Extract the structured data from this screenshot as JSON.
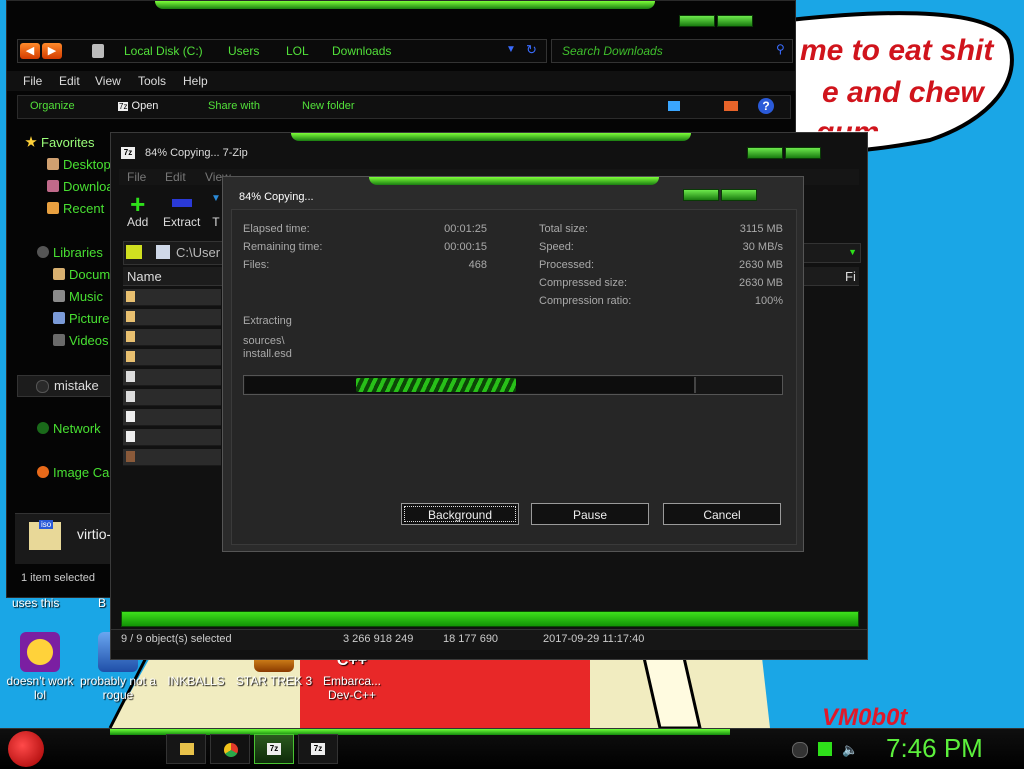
{
  "wallpaper": {
    "speech_lines": [
      "me to eat shit",
      "e and chew",
      "gum"
    ],
    "watermark": "VM0b0t"
  },
  "desktop_icons": [
    {
      "label": "doesn't work lol",
      "color": "#e02a6a"
    },
    {
      "label": "probably not a rogue",
      "color": "#3a78d8"
    },
    {
      "label": "INKBALLS",
      "color": "#d8302a"
    },
    {
      "label": "STAR TREK 3",
      "color": "#c89a2a"
    },
    {
      "label": "Embarca... Dev-C++",
      "color": "#c02a2a"
    }
  ],
  "desktop_top_labels": [
    "uses this",
    "B"
  ],
  "explorer": {
    "address": {
      "crumbs": [
        "Local Disk (C:)",
        "Users",
        "LOL",
        "Downloads"
      ]
    },
    "search_placeholder": "Search Downloads",
    "menu": [
      "File",
      "Edit",
      "View",
      "Tools",
      "Help"
    ],
    "commands": {
      "organize": "Organize",
      "open": "Open",
      "share": "Share with",
      "new_folder": "New folder"
    },
    "nav": {
      "favorites": "Favorites",
      "desktop": "Desktop",
      "downloads": "Downloads",
      "recent": "Recent",
      "libraries": "Libraries",
      "documents": "Documents",
      "music": "Music",
      "pictures": "Pictures",
      "videos": "Videos",
      "mistake": "mistake",
      "network": "Network",
      "image": "Image Ca"
    },
    "selected_file": "virtio-",
    "status": "1 item selected"
  },
  "zip": {
    "title": "84% Copying... 7-Zip",
    "menu": [
      "File",
      "Edit",
      "View"
    ],
    "tools": {
      "add": "Add",
      "extract": "Extract",
      "test": "T"
    },
    "path": "C:\\User",
    "column_name": "Name",
    "column_fi": "Fi",
    "status": {
      "objects": "9 / 9 object(s) selected",
      "size": "3 266 918 249",
      "packed": "18 177 690",
      "date": "2017-09-29 11:17:40"
    }
  },
  "dialog": {
    "title": "84% Copying...",
    "left_stats": [
      {
        "label": "Elapsed time:",
        "value": "00:01:25"
      },
      {
        "label": "Remaining time:",
        "value": "00:00:15"
      },
      {
        "label": "Files:",
        "value": "468"
      }
    ],
    "right_stats": [
      {
        "label": "Total size:",
        "value": "3115 MB"
      },
      {
        "label": "Speed:",
        "value": "30 MB/s"
      },
      {
        "label": "Processed:",
        "value": "2630 MB"
      },
      {
        "label": "Compressed size:",
        "value": "2630 MB"
      },
      {
        "label": "Compression ratio:",
        "value": "100%"
      }
    ],
    "operation": "Extracting",
    "path_line1": "sources\\",
    "path_line2": "install.esd",
    "progress_percent": 84,
    "buttons": {
      "background": "Background",
      "pause": "Pause",
      "cancel": "Cancel"
    }
  },
  "taskbar": {
    "clock": "7:46 PM",
    "apps": [
      "explorer",
      "chrome",
      "7zip",
      "7zip"
    ]
  },
  "colors": {
    "accent": "#48e032",
    "desktop": "#1aa6e6"
  }
}
